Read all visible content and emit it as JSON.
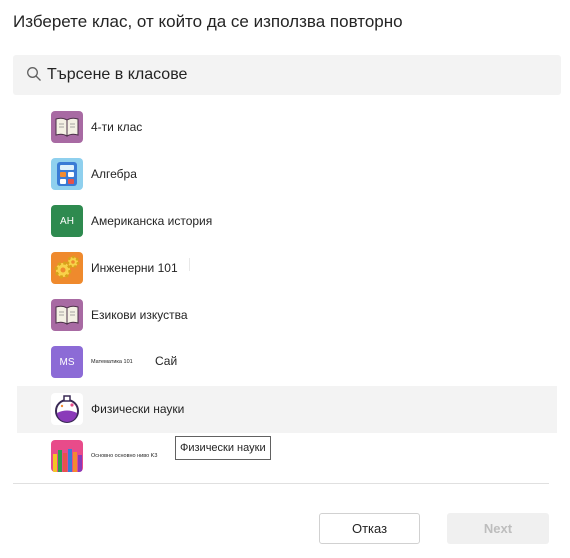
{
  "dialog": {
    "title": "Изберете клас, от който да се използва повторно",
    "search_placeholder": "Търсене в класове",
    "classes": [
      {
        "label": "4-ти клас",
        "icon": "book-icon"
      },
      {
        "label": "Алгебра",
        "icon": "calculator-icon"
      },
      {
        "label": "Американска история",
        "icon": "initials",
        "initials": "AH"
      },
      {
        "label": "Инженерни 101",
        "icon": "gears-icon"
      },
      {
        "label": "Езикови изкуства",
        "icon": "book-icon"
      },
      {
        "label": "Математика 101",
        "extra_label": "Сай",
        "icon": "initials",
        "initials": "MS"
      },
      {
        "label": "Физически науки",
        "icon": "flask-icon"
      },
      {
        "label": "Основно основно ниво K3",
        "icon": "pencils-icon"
      }
    ],
    "tooltip": "Физически науки",
    "cancel_label": "Отказ",
    "next_label": "Next"
  },
  "colors": {
    "book_tile": "#a86aa3",
    "calculator_tile": "#8fd0ee",
    "history_tile": "#2e8a4f",
    "gears_tile": "#ef8a2d",
    "math_tile": "#8c6bd6",
    "flask_tile": "#ffffff",
    "pencils_tile": "#e84b8a"
  }
}
